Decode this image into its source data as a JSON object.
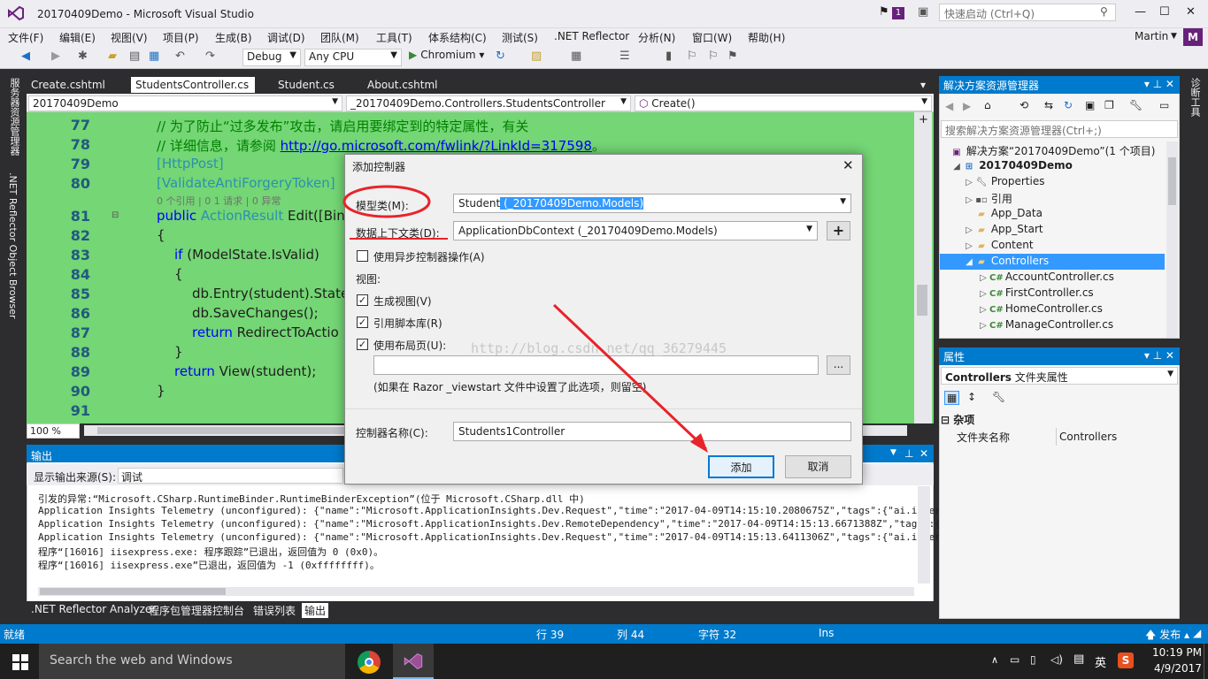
{
  "window": {
    "title": "20170409Demo - Microsoft Visual Studio",
    "quick_launch": "快速启动 (Ctrl+Q)",
    "notify_count": "1",
    "user": "Martin",
    "avatar": "M"
  },
  "menu": [
    "文件(F)",
    "编辑(E)",
    "视图(V)",
    "项目(P)",
    "生成(B)",
    "调试(D)",
    "团队(M)",
    "工具(T)",
    "体系结构(C)",
    "测试(S)",
    ".NET Reflector",
    "分析(N)",
    "窗口(W)",
    "帮助(H)"
  ],
  "toolbar": {
    "config": "Debug",
    "platform": "Any CPU",
    "run": "Chromium"
  },
  "left_side": [
    "服务器资源管理器",
    ".NET Reflector Object Browser"
  ],
  "right_side": "诊断工具",
  "tabs": [
    "Create.cshtml",
    "StudentsController.cs",
    "Student.cs",
    "About.cshtml"
  ],
  "nav": {
    "project": "20170409Demo",
    "class": "_20170409Demo.Controllers.StudentsController",
    "member": "Create()"
  },
  "code": {
    "lines": [
      "77",
      "78",
      "79",
      "80",
      "81",
      "82",
      "83",
      "84",
      "85",
      "86",
      "87",
      "88",
      "89",
      "90",
      "91"
    ],
    "l77": "// 为了防止“过多发布”攻击，请启用要绑定到的特定属性，有关",
    "l78a": "// 详细信息，请参阅 ",
    "l78link": "http://go.microsoft.com/fwlink/?LinkId=317598",
    "l78b": "。",
    "l79": "[HttpPost]",
    "l80": "[ValidateAntiForgeryToken]",
    "hint": "0 个引用 | 0 1 请求 | 0 异常",
    "l81a": "public ",
    "l81b": "ActionResult",
    "l81c": " Edit([Bin",
    "l82": "{",
    "l83a": "if",
    "l83b": " (ModelState.IsValid)",
    "l84": "{",
    "l85": "db.Entry(student).State",
    "l86": "db.SaveChanges();",
    "l87a": "return",
    "l87b": " RedirectToActio",
    "l88": "}",
    "l89a": "return",
    "l89b": " View(student);",
    "l90": "}"
  },
  "zoom": "100 %",
  "output": {
    "title": "输出",
    "source_label": "显示输出来源(S):",
    "source_value": "调试",
    "lines": [
      "引发的异常:“Microsoft.CSharp.RuntimeBinder.RuntimeBinderException”(位于 Microsoft.CSharp.dll 中)",
      "Application Insights Telemetry (unconfigured): {\"name\":\"Microsoft.ApplicationInsights.Dev.Request\",\"time\":\"2017-04-09T14:15:10.2080675Z\",\"tags\":{\"ai.internal.sdkVersi",
      "Application Insights Telemetry (unconfigured): {\"name\":\"Microsoft.ApplicationInsights.Dev.RemoteDependency\",\"time\":\"2017-04-09T14:15:13.6671388Z\",\"tags\":{\"ai.internal",
      "Application Insights Telemetry (unconfigured): {\"name\":\"Microsoft.ApplicationInsights.Dev.Request\",\"time\":\"2017-04-09T14:15:13.6411306Z\",\"tags\":{\"ai.internal.sdkVersi",
      "程序“[16016] iisexpress.exe: 程序跟踪”已退出，返回值为 0 (0x0)。",
      "程序“[16016] iisexpress.exe”已退出，返回值为 -1 (0xffffffff)。"
    ]
  },
  "bottom_tabs": [
    ".NET Reflector Analyzer",
    "程序包管理器控制台",
    "错误列表",
    "输出"
  ],
  "solution": {
    "title": "解决方案资源管理器",
    "search": "搜索解决方案资源管理器(Ctrl+;)",
    "items": [
      "解决方案“20170409Demo”(1 个项目)",
      "20170409Demo",
      "Properties",
      "引用",
      "App_Data",
      "App_Start",
      "Content",
      "Controllers",
      "AccountController.cs",
      "FirstController.cs",
      "HomeController.cs",
      "ManageController.cs"
    ]
  },
  "properties": {
    "title": "属性",
    "object": "Controllers",
    "object_type": "文件夹属性",
    "category": "杂项",
    "prop_name": "文件夹名称",
    "prop_value": "Controllers"
  },
  "dialog": {
    "title": "添加控制器",
    "model_label": "模型类(M):",
    "model_value": "Student",
    "model_ns": " (_20170409Demo.Models)",
    "context_label": "数据上下文类(D):",
    "context_value": "ApplicationDbContext (_20170409Demo.Models)",
    "add_ctx": "+",
    "async": "使用异步控制器操作(A)",
    "views": "视图:",
    "gen_views": "生成视图(V)",
    "ref_scripts": "引用脚本库(R)",
    "use_layout": "使用布局页(U):",
    "browse": "...",
    "note": "(如果在 Razor _viewstart 文件中设置了此选项，则留空)",
    "name_label": "控制器名称(C):",
    "name_value": "Students1Controller",
    "ok": "添加",
    "cancel": "取消"
  },
  "watermark": "http://blog.csdn.net/qq_36279445",
  "status": {
    "ready": "就绪",
    "row": "行 39",
    "col": "列 44",
    "char": "字符 32",
    "ins": "Ins",
    "publish": "发布"
  },
  "taskbar": {
    "search": "Search the web and Windows",
    "ime": "英",
    "time": "10:19 PM",
    "date": "4/9/2017"
  }
}
